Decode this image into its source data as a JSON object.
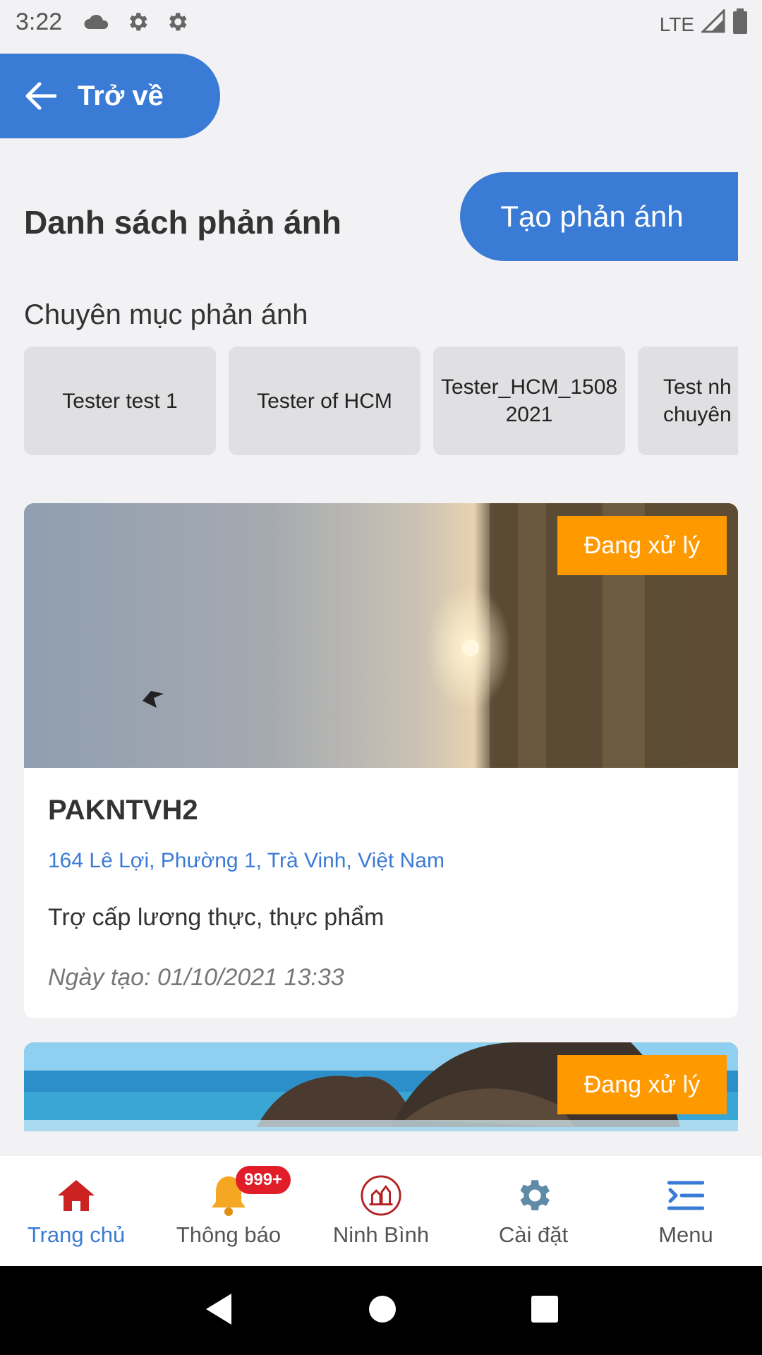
{
  "status_bar": {
    "time": "3:22",
    "network": "LTE"
  },
  "back_button": {
    "label": "Trở về"
  },
  "header": {
    "title": "Danh sách phản ánh",
    "create_label": "Tạo phản ánh"
  },
  "categories": {
    "label": "Chuyên mục phản ánh",
    "items": [
      "Tester test 1",
      "Tester of HCM",
      "Tester_HCM_1508\n2021",
      "Test nh\nchuyên"
    ]
  },
  "reports": [
    {
      "status": "Đang xử lý",
      "title": "PAKNTVH2",
      "address": "164 Lê Lợi, Phường 1, Trà Vinh, Việt Nam",
      "category": "Trợ cấp lương thực, thực phẩm",
      "created": "Ngày tạo: 01/10/2021 13:33"
    },
    {
      "status": "Đang xử lý"
    }
  ],
  "bottom_nav": {
    "items": [
      {
        "label": "Trang chủ",
        "icon": "home-icon"
      },
      {
        "label": "Thông báo",
        "icon": "bell-icon",
        "badge": "999+"
      },
      {
        "label": "Ninh Bình",
        "icon": "ninh-binh-logo"
      },
      {
        "label": "Cài đặt",
        "icon": "gear-icon"
      },
      {
        "label": "Menu",
        "icon": "menu-icon"
      }
    ]
  },
  "colors": {
    "primary": "#3a7bd5",
    "status": "#ff9900",
    "badge": "#e11d2a",
    "home": "#cc2222"
  }
}
